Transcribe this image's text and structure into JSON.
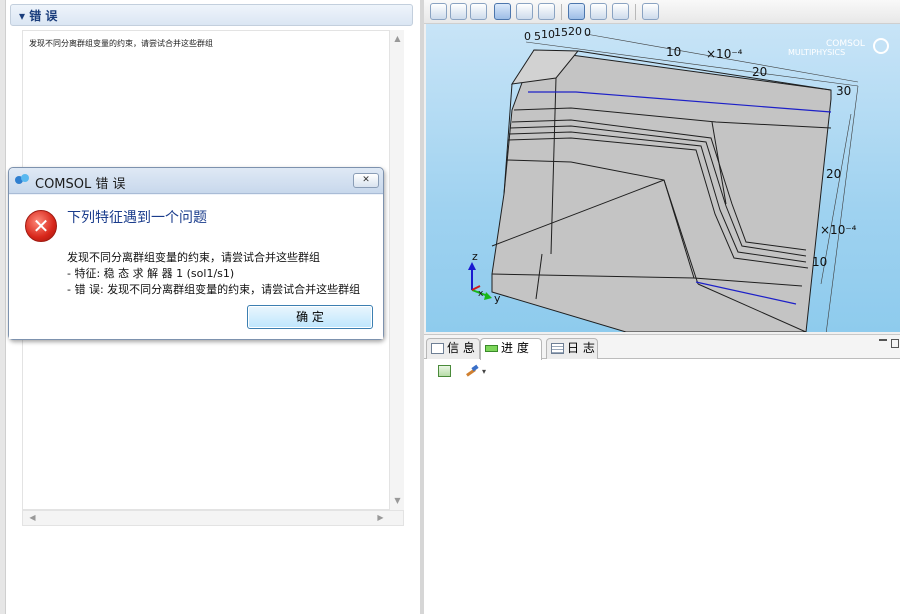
{
  "left_panel": {
    "section_title": "▾ 错 误",
    "error_text": "发现不同分离群组变量的约束，请尝试合并这些群组"
  },
  "graphics": {
    "brand_line1": "COMSOL",
    "brand_line2": "MULTIPHYSICS",
    "top_ticks": [
      "0",
      "5",
      "10",
      "15",
      "20",
      "0"
    ],
    "top_axis_labels": [
      "10",
      "20",
      "30"
    ],
    "top_scale": "×10⁻⁴",
    "right_axis_labels": [
      "20",
      "10"
    ],
    "right_scale": "×10⁻⁴",
    "axis_z": "z",
    "axis_y": "y",
    "axis_x": "x",
    "colors": {
      "background_top": "#c8e4f7",
      "background_bottom": "#8ecbed",
      "solid": "#c0c0c0",
      "edges": "#1f1f1f",
      "highlight_edges": "#1d20c8"
    }
  },
  "toolbar": {
    "icons": [
      "zoom-box-icon",
      "zoom-in-icon",
      "zoom-out-icon",
      "zoom-extents-icon",
      "rotate-icon",
      "pan-icon",
      "select-icon",
      "select-box-icon",
      "deselect-icon",
      "screenshot-icon"
    ]
  },
  "bottom_panel": {
    "tabs": [
      {
        "label": "信 息",
        "icon": "message-icon"
      },
      {
        "label": "进 度",
        "icon": "progress-icon"
      },
      {
        "label": "日 志",
        "icon": "log-icon"
      }
    ],
    "selected_tab": "进 度"
  },
  "dialog": {
    "title": "COMSOL 错 误",
    "heading": "下列特征遇到一个问题",
    "message": "发现不同分离群组变量的约束，请尝试合并这些群组",
    "detail_feature": "- 特征: 稳 态 求 解 器 1 (sol1/s1)",
    "detail_error": "- 错 误: 发现不同分离群组变量的约束，请尝试合并这些群组",
    "ok_label": "确 定",
    "close_label": "✕",
    "error_icon": "error-icon"
  }
}
